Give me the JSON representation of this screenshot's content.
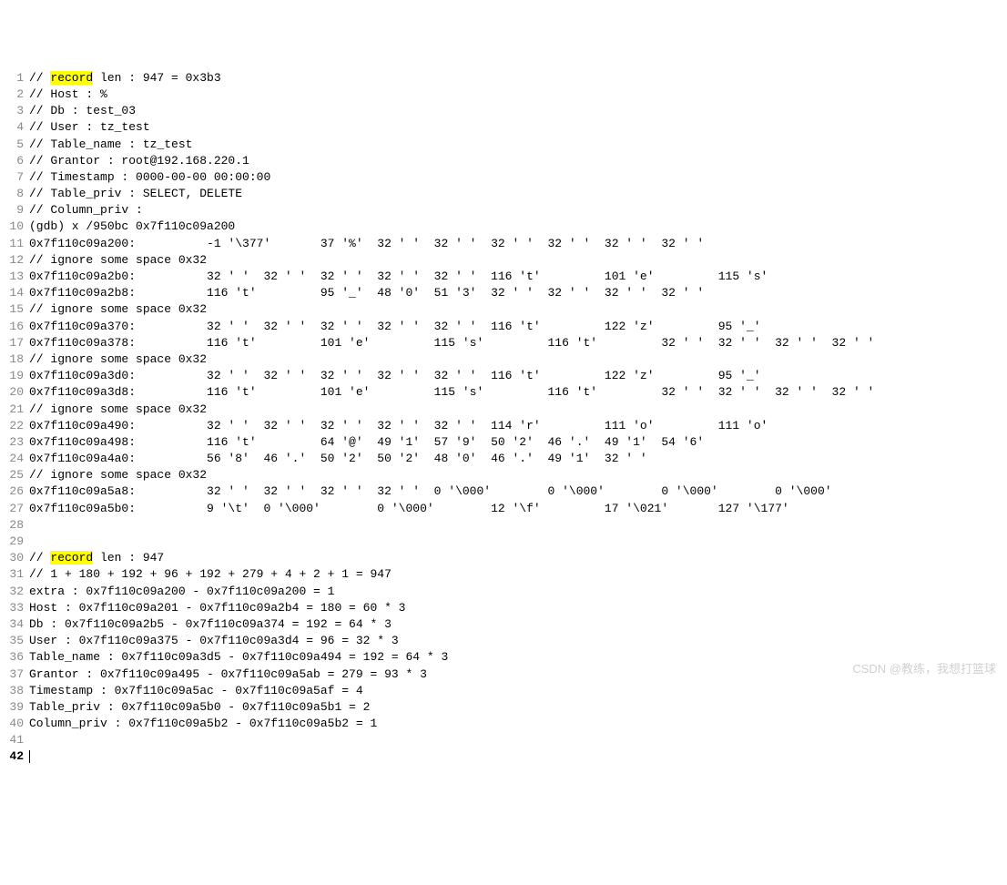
{
  "lines": [
    {
      "num": 1,
      "prefix": "// ",
      "highlight": "record",
      "rest": " len : 947 = 0x3b3"
    },
    {
      "num": 2,
      "text": "// Host : %"
    },
    {
      "num": 3,
      "text": "// Db : test_03"
    },
    {
      "num": 4,
      "text": "// User : tz_test"
    },
    {
      "num": 5,
      "text": "// Table_name : tz_test"
    },
    {
      "num": 6,
      "text": "// Grantor : root@192.168.220.1"
    },
    {
      "num": 7,
      "text": "// Timestamp : 0000-00-00 00:00:00"
    },
    {
      "num": 8,
      "text": "// Table_priv : SELECT, DELETE"
    },
    {
      "num": 9,
      "text": "// Column_priv :"
    },
    {
      "num": 10,
      "text": "(gdb) x /950bc 0x7f110c09a200"
    },
    {
      "num": 11,
      "text": "0x7f110c09a200:          -1 '\\377'       37 '%'  32 ' '  32 ' '  32 ' '  32 ' '  32 ' '  32 ' '"
    },
    {
      "num": 12,
      "text": "// ignore some space 0x32"
    },
    {
      "num": 13,
      "text": "0x7f110c09a2b0:          32 ' '  32 ' '  32 ' '  32 ' '  32 ' '  116 't'         101 'e'         115 's'"
    },
    {
      "num": 14,
      "text": "0x7f110c09a2b8:          116 't'         95 '_'  48 '0'  51 '3'  32 ' '  32 ' '  32 ' '  32 ' '"
    },
    {
      "num": 15,
      "text": "// ignore some space 0x32"
    },
    {
      "num": 16,
      "text": "0x7f110c09a370:          32 ' '  32 ' '  32 ' '  32 ' '  32 ' '  116 't'         122 'z'         95 '_'"
    },
    {
      "num": 17,
      "text": "0x7f110c09a378:          116 't'         101 'e'         115 's'         116 't'         32 ' '  32 ' '  32 ' '  32 ' '"
    },
    {
      "num": 18,
      "text": "// ignore some space 0x32"
    },
    {
      "num": 19,
      "text": "0x7f110c09a3d0:          32 ' '  32 ' '  32 ' '  32 ' '  32 ' '  116 't'         122 'z'         95 '_'"
    },
    {
      "num": 20,
      "text": "0x7f110c09a3d8:          116 't'         101 'e'         115 's'         116 't'         32 ' '  32 ' '  32 ' '  32 ' '"
    },
    {
      "num": 21,
      "text": "// ignore some space 0x32"
    },
    {
      "num": 22,
      "text": "0x7f110c09a490:          32 ' '  32 ' '  32 ' '  32 ' '  32 ' '  114 'r'         111 'o'         111 'o'"
    },
    {
      "num": 23,
      "text": "0x7f110c09a498:          116 't'         64 '@'  49 '1'  57 '9'  50 '2'  46 '.'  49 '1'  54 '6'"
    },
    {
      "num": 24,
      "text": "0x7f110c09a4a0:          56 '8'  46 '.'  50 '2'  50 '2'  48 '0'  46 '.'  49 '1'  32 ' '"
    },
    {
      "num": 25,
      "text": "// ignore some space 0x32"
    },
    {
      "num": 26,
      "text": "0x7f110c09a5a8:          32 ' '  32 ' '  32 ' '  32 ' '  0 '\\000'        0 '\\000'        0 '\\000'        0 '\\000'"
    },
    {
      "num": 27,
      "text": "0x7f110c09a5b0:          9 '\\t'  0 '\\000'        0 '\\000'        12 '\\f'         17 '\\021'       127 '\\177'"
    },
    {
      "num": 28,
      "text": ""
    },
    {
      "num": 29,
      "text": ""
    },
    {
      "num": 30,
      "prefix": "// ",
      "highlight": "record",
      "rest": " len : 947"
    },
    {
      "num": 31,
      "text": "// 1 + 180 + 192 + 96 + 192 + 279 + 4 + 2 + 1 = 947"
    },
    {
      "num": 32,
      "text": "extra : 0x7f110c09a200 - 0x7f110c09a200 = 1"
    },
    {
      "num": 33,
      "text": "Host : 0x7f110c09a201 - 0x7f110c09a2b4 = 180 = 60 * 3"
    },
    {
      "num": 34,
      "text": "Db : 0x7f110c09a2b5 - 0x7f110c09a374 = 192 = 64 * 3"
    },
    {
      "num": 35,
      "text": "User : 0x7f110c09a375 - 0x7f110c09a3d4 = 96 = 32 * 3"
    },
    {
      "num": 36,
      "text": "Table_name : 0x7f110c09a3d5 - 0x7f110c09a494 = 192 = 64 * 3"
    },
    {
      "num": 37,
      "text": "Grantor : 0x7f110c09a495 - 0x7f110c09a5ab = 279 = 93 * 3"
    },
    {
      "num": 38,
      "text": "Timestamp : 0x7f110c09a5ac - 0x7f110c09a5af = 4"
    },
    {
      "num": 39,
      "text": "Table_priv : 0x7f110c09a5b0 - 0x7f110c09a5b1 = 2"
    },
    {
      "num": 40,
      "text": "Column_priv : 0x7f110c09a5b2 - 0x7f110c09a5b2 = 1"
    },
    {
      "num": 41,
      "text": ""
    },
    {
      "num": 42,
      "text": "",
      "current": true,
      "cursor": true
    }
  ],
  "watermark": "CSDN @教练，我想打篮球"
}
